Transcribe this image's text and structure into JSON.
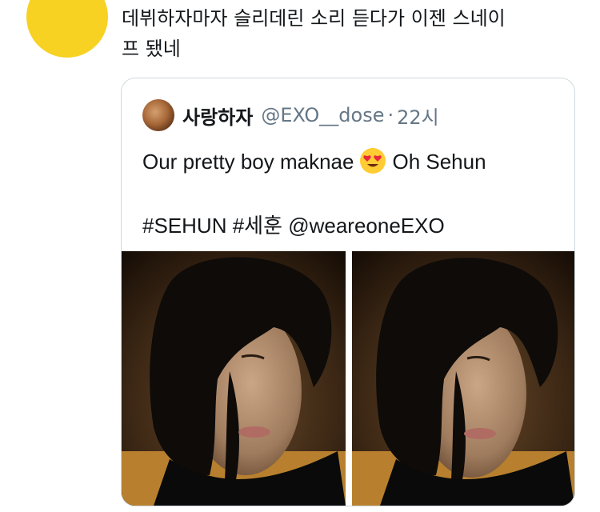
{
  "tweet": {
    "avatar_color": "#f7d223",
    "text": "데뷔하자마자 슬리데린 소리 듣다가 이젠 스네이\n프 됐네"
  },
  "quoted_tweet": {
    "display_name": "사랑하자",
    "handle": "@EXO__dose",
    "separator": "·",
    "time": "22시",
    "line1_before": "Our pretty boy maknae",
    "emoji": "heart-eyes-emoji",
    "line1_after": "Oh Sehun",
    "line2": "#SEHUN #세훈 @weareoneEXO",
    "photos": [
      {
        "name": "photo-1"
      },
      {
        "name": "photo-2"
      }
    ]
  },
  "colors": {
    "text": "#14171a",
    "muted": "#657786",
    "border": "#cfd9de"
  }
}
